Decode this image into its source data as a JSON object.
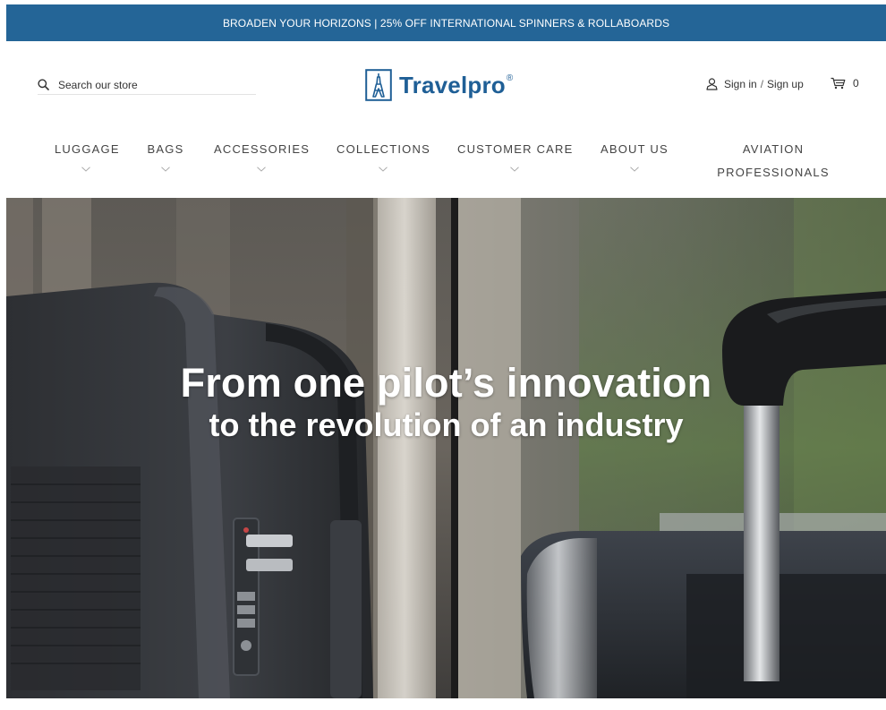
{
  "promo": {
    "text": "BROADEN YOUR HORIZONS | 25% OFF INTERNATIONAL SPINNERS & ROLLABOARDS"
  },
  "header": {
    "search_placeholder": "Search our store",
    "logo_text": "Travelpro",
    "logo_mark": "®",
    "sign_in": "Sign in",
    "separator": "/",
    "sign_up": "Sign up",
    "cart_count": "0"
  },
  "nav": {
    "items": [
      {
        "label": "LUGGAGE",
        "has_dropdown": true
      },
      {
        "label": "BAGS",
        "has_dropdown": true
      },
      {
        "label": "ACCESSORIES",
        "has_dropdown": true
      },
      {
        "label": "COLLECTIONS",
        "has_dropdown": true
      },
      {
        "label": "CUSTOMER CARE",
        "has_dropdown": true
      },
      {
        "label": "ABOUT US",
        "has_dropdown": true
      },
      {
        "label_line1": "AVIATION",
        "label_line2": "PROFESSIONALS",
        "has_dropdown": false
      }
    ]
  },
  "hero": {
    "line1": "From one pilot’s innovation",
    "line2": "to the revolution of an industry"
  },
  "colors": {
    "promo_bg": "#246597",
    "brand_blue": "#1f5f96",
    "text": "#333333"
  },
  "icons": {
    "search": "search-icon",
    "logo": "eiffel-tower-logo-icon",
    "user": "user-icon",
    "cart": "cart-icon",
    "chevron": "chevron-down-icon"
  }
}
